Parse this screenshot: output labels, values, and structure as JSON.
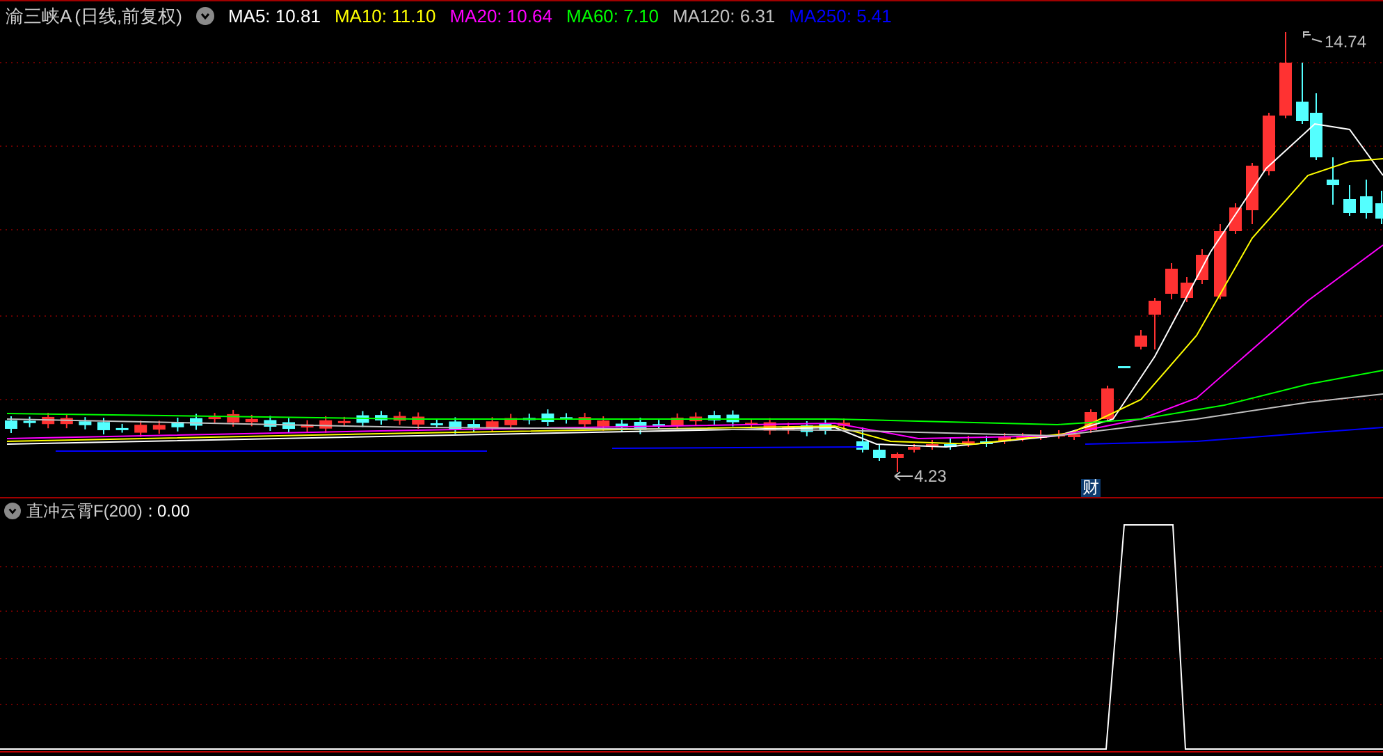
{
  "title": {
    "stock": "渝三峡A",
    "period": "(日线,前复权)"
  },
  "ma": [
    {
      "label": "MA5: 10.81",
      "color": "#ffffff"
    },
    {
      "label": "MA10: 11.10",
      "color": "#ffff00"
    },
    {
      "label": "MA20: 10.64",
      "color": "#ff00ff"
    },
    {
      "label": "MA60: 7.10",
      "color": "#00ff00"
    },
    {
      "label": "MA120: 6.31",
      "color": "#c0c0c0"
    },
    {
      "label": "MA250: 5.41",
      "color": "#0000ff"
    }
  ],
  "price_markers": {
    "high": "14.74",
    "low": "4.23"
  },
  "event_badge": "财",
  "indicator": {
    "label": "直冲云霄F(200)",
    "value": ": 0.00"
  }
}
